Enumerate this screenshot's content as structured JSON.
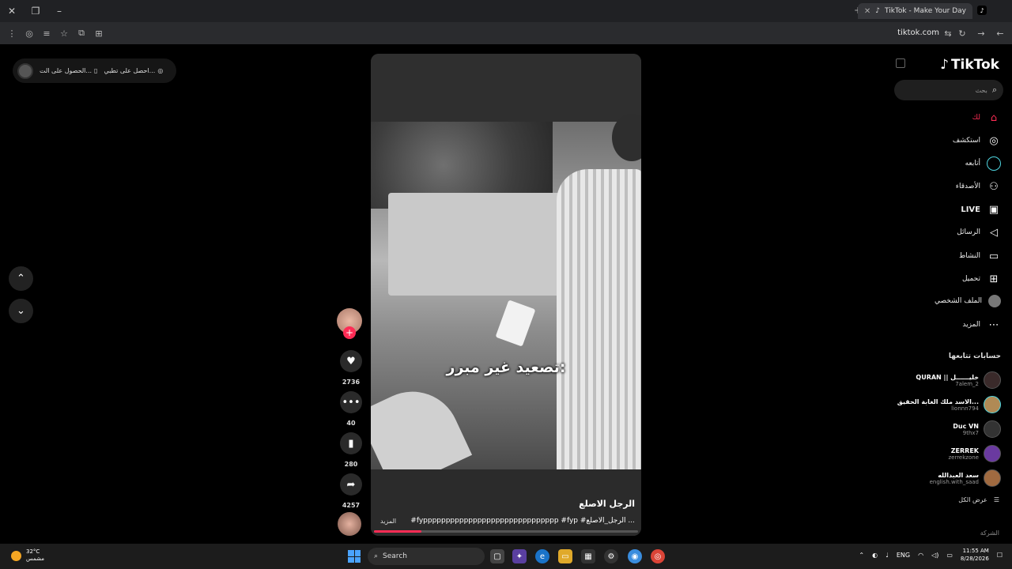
{
  "browser": {
    "tab_title": "TikTok - Make Your Day",
    "url": "tiktok.com"
  },
  "get_app": {
    "app_label": "احصل على تطبيق TikTok",
    "app_label_visible": "احصل على تطبي...",
    "pc_label": "الحصول على الت...",
    "pc_label_full": "الحصول على التطبيق"
  },
  "video": {
    "subtitle": "تصعيد غير مبرر:",
    "caption_title": "الرجل الاصلع",
    "caption_tags": "#fypppppppppppppppppppppppppppppp #fyp #الرجل_الاصلع ...",
    "more_label": "المزيد",
    "progress_fraction": 0.18
  },
  "actions": {
    "likes": "2736",
    "comments": "40",
    "saves": "280",
    "shares": "4257"
  },
  "sidebar": {
    "logo": "TikTok",
    "search_placeholder": "بحث",
    "nav": [
      {
        "label": "لك",
        "icon": "home-icon",
        "active": true
      },
      {
        "label": "استكشف",
        "icon": "compass-icon"
      },
      {
        "label": "أتابعه",
        "icon": "following-icon"
      },
      {
        "label": "الأصدقاء",
        "icon": "friends-icon"
      },
      {
        "label": "LIVE",
        "icon": "live-icon"
      },
      {
        "label": "الرسائل",
        "icon": "messages-icon"
      },
      {
        "label": "النشاط",
        "icon": "activity-icon"
      },
      {
        "label": "تحميل",
        "icon": "upload-icon"
      },
      {
        "label": "الملف الشخصي",
        "icon": "profile-icon"
      },
      {
        "label": "المزيد",
        "icon": "more-icon"
      }
    ],
    "following_header": "حسابات تتابعها",
    "accounts": [
      {
        "name": "QURAN || خليــــــل",
        "user": "7alem_2"
      },
      {
        "name": "الاسد ملك الغابة الحقيق...",
        "user": "lionnn794"
      },
      {
        "name": "Duc VN",
        "user": "9thx7"
      },
      {
        "name": "ZERREK",
        "user": "zerrekzone"
      },
      {
        "name": "سعد العبدالله",
        "user": "english.with_saad"
      }
    ],
    "see_all": "عرض الكل",
    "company": "الشركة"
  },
  "taskbar": {
    "temp": "32°C",
    "weather": "مشمس",
    "search": "Search",
    "lang": "ENG",
    "time": "11:55 AM",
    "date": "8/28/2026"
  },
  "colors": {
    "accent": "#fe2c55",
    "bg": "#000000"
  }
}
